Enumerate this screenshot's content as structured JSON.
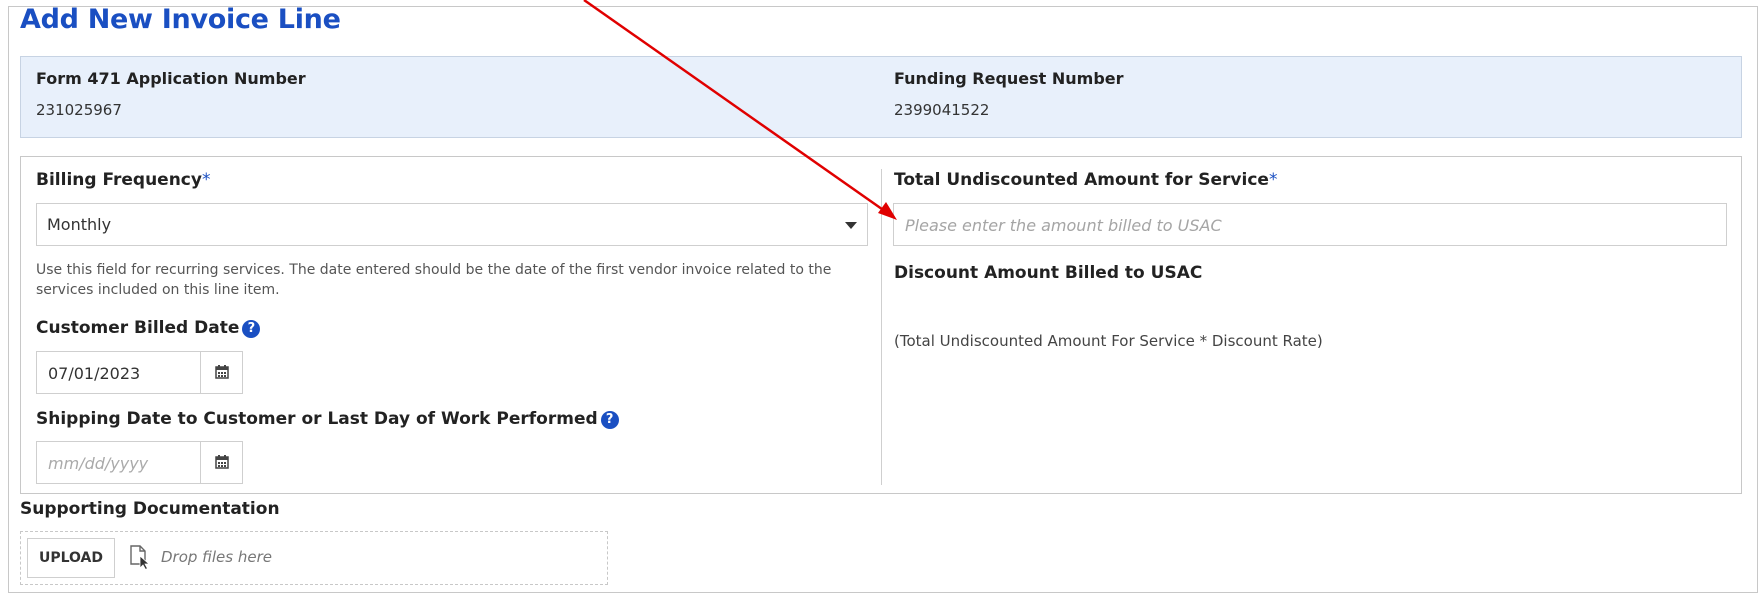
{
  "title": "Add New Invoice Line",
  "application": {
    "label": "Form 471 Application Number",
    "value": "231025967"
  },
  "funding_request": {
    "label": "Funding Request Number",
    "value": "2399041522"
  },
  "billing_frequency": {
    "label": "Billing Frequency",
    "required_mark": "*",
    "selected": "Monthly"
  },
  "help_text": "Use this field for recurring services. The date entered should be the date of the first vendor invoice related to the services included on this line item.",
  "customer_billed_date": {
    "label": "Customer Billed Date",
    "value": "07/01/2023"
  },
  "shipping_date": {
    "label": "Shipping Date to Customer or Last Day of Work Performed",
    "placeholder": "mm/dd/yyyy"
  },
  "total_undiscounted": {
    "label": "Total Undiscounted Amount for Service",
    "required_mark": "*",
    "placeholder": "Please enter the amount billed to USAC"
  },
  "discount_amount": {
    "label": "Discount Amount Billed to USAC",
    "formula": "(Total Undiscounted Amount For Service * Discount Rate)"
  },
  "supporting_documentation": {
    "label": "Supporting Documentation",
    "upload_label": "UPLOAD",
    "drop_text": "Drop files here"
  },
  "icons": {
    "help": "question-circle-icon",
    "calendar": "calendar-icon",
    "file": "file-cursor-icon",
    "annotation": "red-arrow"
  },
  "colors": {
    "accent": "#1a4fc2",
    "info_panel_bg": "#e8f0fb",
    "annotation_arrow": "#e00000"
  }
}
